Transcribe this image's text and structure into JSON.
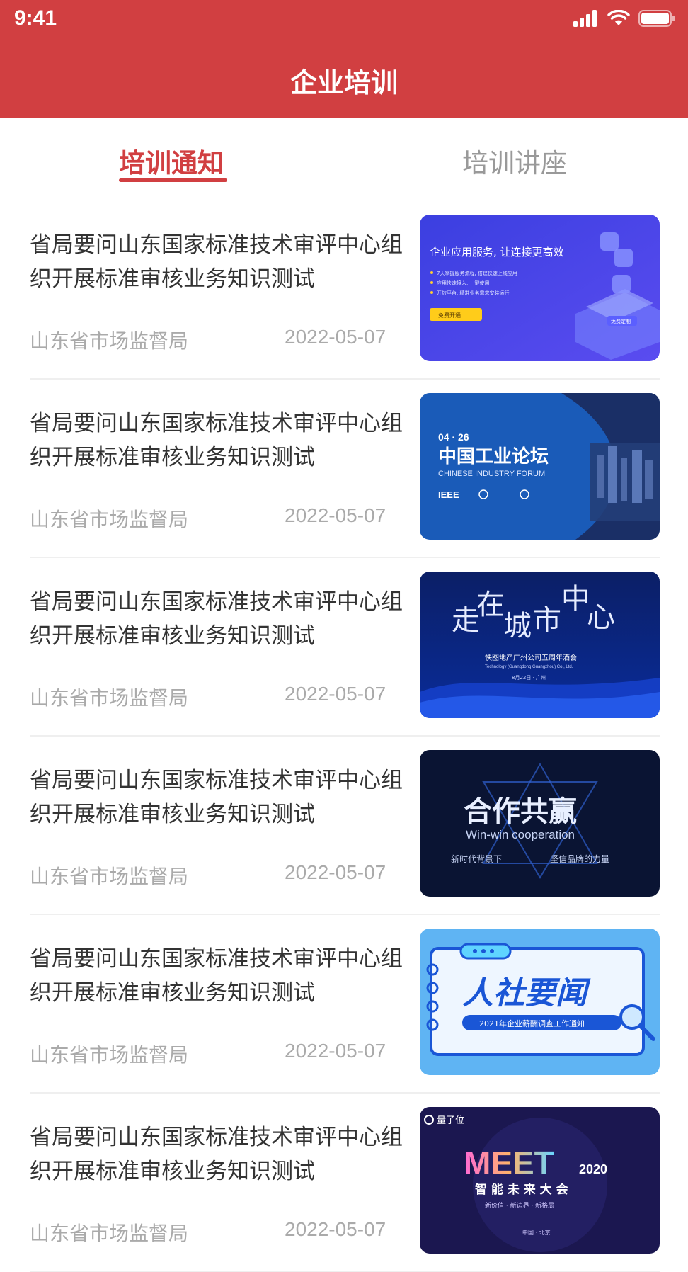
{
  "status_bar": {
    "time": "9:41"
  },
  "header": {
    "title": "企业培训"
  },
  "tabs": [
    {
      "label": "培训通知",
      "active": true
    },
    {
      "label": "培训讲座",
      "active": false
    }
  ],
  "colors": {
    "brand": "#d13f41",
    "text": "#333333",
    "muted": "#aaaaaa",
    "tab_inactive": "#999999"
  },
  "items": [
    {
      "title": "省局要问山东国家标准技术审评中心组织开展标准审核业务知识测试",
      "source": "山东省市场监督局",
      "date": "2022-05-07",
      "thumb": {
        "headline": "企业应用服务, 让连接更高效",
        "bullets": [
          "7天掌握服务流程, 搭建快速上线应用",
          "应用快速接入, 一键使用",
          "开放平台, 精准业务需求安装运行"
        ],
        "button": "免费开通",
        "corner": "免费定制"
      }
    },
    {
      "title": "省局要问山东国家标准技术审评中心组织开展标准审核业务知识测试",
      "source": "山东省市场监督局",
      "date": "2022-05-07",
      "thumb": {
        "date": "04 · 26",
        "headline": "中国工业论坛",
        "subtitle": "CHINESE INDUSTRY FORUM",
        "logo": "IEEE"
      }
    },
    {
      "title": "省局要问山东国家标准技术审评中心组织开展标准审核业务知识测试",
      "source": "山东省市场监督局",
      "date": "2022-05-07",
      "thumb": {
        "chars": [
          "走",
          "在",
          "城",
          "市",
          "中",
          "心"
        ],
        "subtitle": "快图地产广州公司五周年酒会",
        "english": "Technology (Guangdong Guangzhou) Co., Ltd.",
        "date": "8月22日 · 广州"
      }
    },
    {
      "title": "省局要问山东国家标准技术审评中心组织开展标准审核业务知识测试",
      "source": "山东省市场监督局",
      "date": "2022-05-07",
      "thumb": {
        "headline": "合作共赢",
        "english": "Win-win cooperation",
        "left": "新时代背景下",
        "right": "坚信品牌的力量"
      }
    },
    {
      "title": "省局要问山东国家标准技术审评中心组织开展标准审核业务知识测试",
      "source": "山东省市场监督局",
      "date": "2022-05-07",
      "thumb": {
        "headline": "人社要闻",
        "ribbon": "2021年企业薪酬调查工作通知"
      }
    },
    {
      "title": "省局要问山东国家标准技术审评中心组织开展标准审核业务知识测试",
      "source": "山东省市场监督局",
      "date": "2022-05-07",
      "thumb": {
        "brand": "量子位",
        "headline": "MEET",
        "year": "2020",
        "subtitle": "智 能 未 来 大 会",
        "tagline": "新价值 · 新边界 · 新格局",
        "place": "中国 · 北京"
      }
    }
  ]
}
